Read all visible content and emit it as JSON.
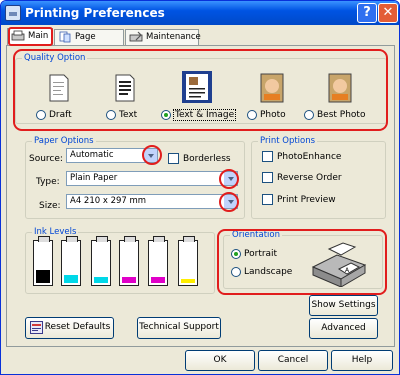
{
  "window": {
    "title": "Printing Preferences",
    "help_glyph": "?",
    "close_glyph": "✕"
  },
  "tabs": [
    {
      "label": "Main"
    },
    {
      "label": "Page Layout"
    },
    {
      "label": "Maintenance"
    }
  ],
  "quality": {
    "label": "Quality Option",
    "options": [
      {
        "label": "Draft",
        "checked": false
      },
      {
        "label": "Text",
        "checked": false
      },
      {
        "label": "Text & Image",
        "checked": true
      },
      {
        "label": "Photo",
        "checked": false
      },
      {
        "label": "Best Photo",
        "checked": false
      }
    ]
  },
  "paper_options": {
    "label": "Paper Options",
    "source_label": "Source:",
    "source_value": "Automatic",
    "borderless_label": "Borderless",
    "type_label": "Type:",
    "type_value": "Plain Paper",
    "size_label": "Size:",
    "size_value": "A4 210 x 297 mm"
  },
  "print_options": {
    "label": "Print Options",
    "items": [
      {
        "label": "PhotoEnhance",
        "checked": false
      },
      {
        "label": "Reverse Order",
        "checked": false
      },
      {
        "label": "Print Preview",
        "checked": false
      }
    ]
  },
  "ink_levels": {
    "label": "Ink Levels",
    "cartridges": [
      {
        "color": "#000000",
        "level": 0.3
      },
      {
        "color": "#00d8e8",
        "level": 0.2
      },
      {
        "color": "#00d8e8",
        "level": 0.15
      },
      {
        "color": "#e000c8",
        "level": 0.15
      },
      {
        "color": "#e000c8",
        "level": 0.15
      },
      {
        "color": "#ffee00",
        "level": 0.1
      }
    ]
  },
  "orientation": {
    "label": "Orientation",
    "options": [
      {
        "label": "Portrait",
        "checked": true
      },
      {
        "label": "Landscape",
        "checked": false
      }
    ]
  },
  "buttons": {
    "show_settings": "Show Settings",
    "reset_defaults": "Reset Defaults",
    "technical_support": "Technical Support",
    "advanced": "Advanced",
    "ok": "OK",
    "cancel": "Cancel",
    "help": "Help"
  },
  "colors": {
    "accent_highlight": "#e11d1d",
    "group_label": "#0046d5",
    "title_bar": "#0054e3"
  }
}
